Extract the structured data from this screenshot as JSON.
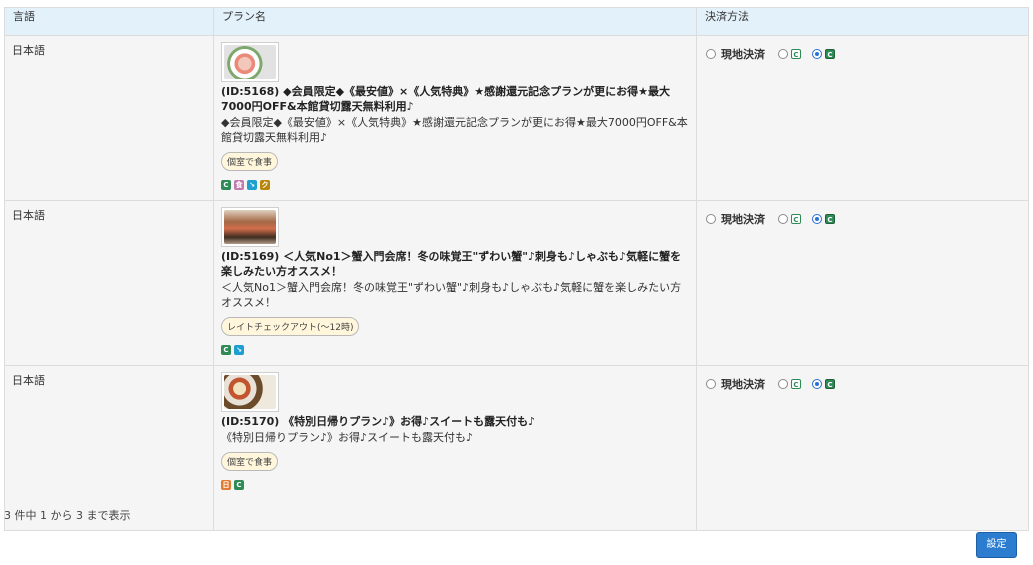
{
  "table": {
    "headers": [
      "言語",
      "プラン名",
      "決済方法"
    ],
    "rows": [
      {
        "lang": "日本語",
        "plan_id": "(ID:5168)",
        "title": "◆会員限定◆《最安値》×《人気特典》★感謝還元記念プランが更にお得★最大7000円OFF&本館貸切露天無料利用♪",
        "desc": "◆会員限定◆《最安値》×《人気特典》★感謝還元記念プランが更にお得★最大7000円OFF&本館貸切露天無料利用♪",
        "tag": "個室で食事",
        "icons": [
          {
            "name": "c-icon",
            "glyph": "C",
            "color": "#2e8b57"
          },
          {
            "name": "meal-icon",
            "glyph": "食",
            "color": "#c07ab0"
          },
          {
            "name": "arrow-icon",
            "glyph": "↘",
            "color": "#1f9fd0"
          },
          {
            "name": "k-icon",
            "glyph": "ク",
            "color": "#b8860b"
          }
        ]
      },
      {
        "lang": "日本語",
        "plan_id": "(ID:5169)",
        "title": "＜人気No1＞蟹入門会席！冬の味覚王\"ずわい蟹\"♪刺身も♪しゃぶも♪気軽に蟹を楽しみたい方オススメ！",
        "desc": "＜人気No1＞蟹入門会席！冬の味覚王\"ずわい蟹\"♪刺身も♪しゃぶも♪気軽に蟹を楽しみたい方オススメ！",
        "tag": "レイトチェックアウト(～12時)",
        "icons": [
          {
            "name": "c-icon",
            "glyph": "C",
            "color": "#2e8b57"
          },
          {
            "name": "arrow-icon",
            "glyph": "↘",
            "color": "#1f9fd0"
          }
        ]
      },
      {
        "lang": "日本語",
        "plan_id": "(ID:5170)",
        "title": "《特別日帰りプラン♪》お得♪スイートも露天付も♪",
        "desc": "《特別日帰りプラン♪》お得♪スイートも露天付も♪",
        "tag": "個室で食事",
        "icons": [
          {
            "name": "day-icon",
            "glyph": "日",
            "color": "#e07a2f"
          },
          {
            "name": "c-icon",
            "glyph": "C",
            "color": "#2e8b57"
          }
        ]
      }
    ],
    "payment": {
      "label": "現地決済",
      "icon_glyph": "C"
    }
  },
  "summary": "3 件中 1 から 3 まで表示",
  "set_button": "設定"
}
